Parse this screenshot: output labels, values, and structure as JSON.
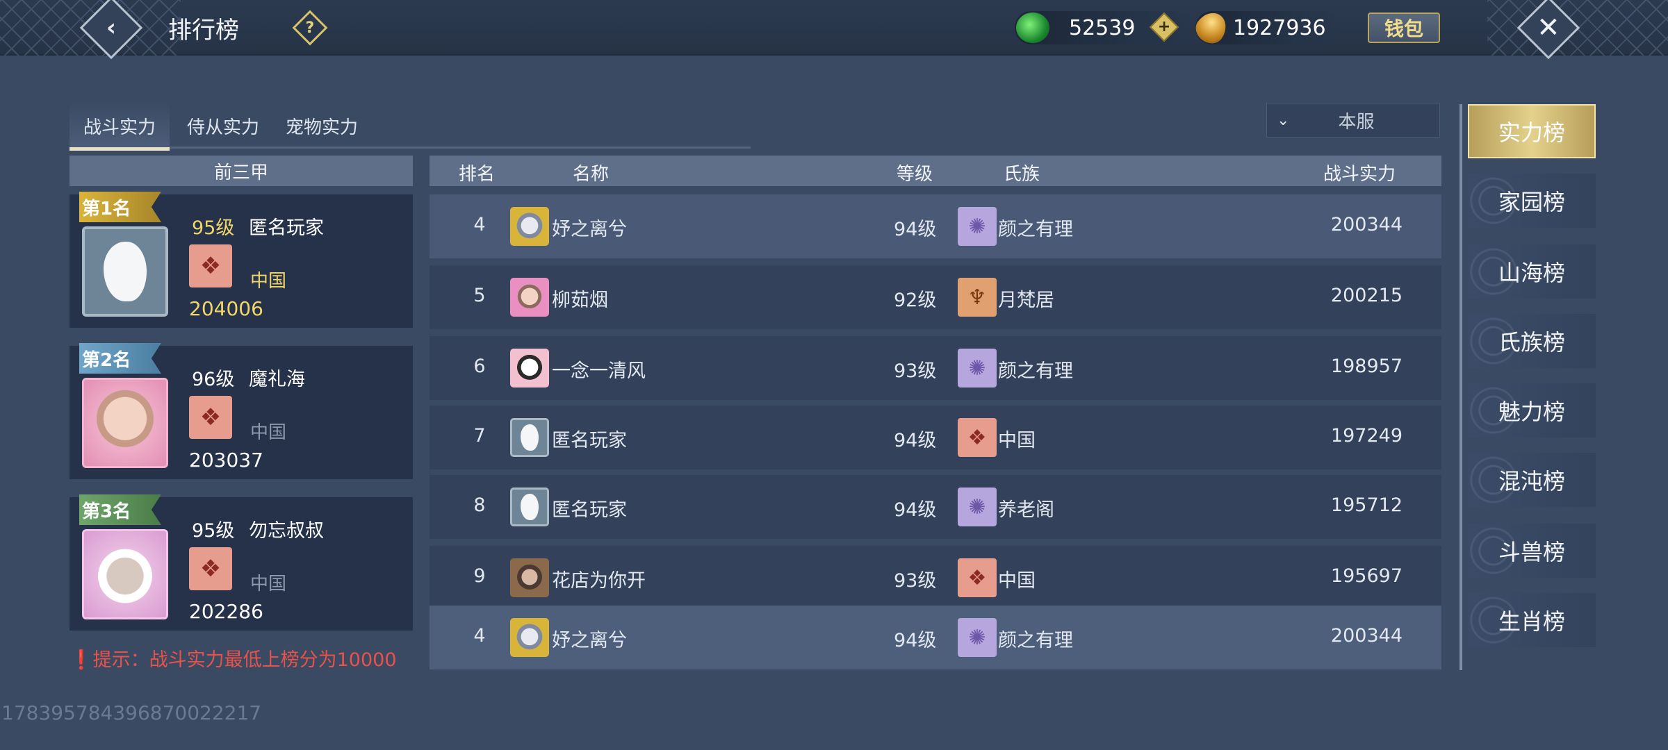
{
  "header": {
    "title": "排行榜",
    "help_icon": "question-icon",
    "jade": "52539",
    "gold": "1927936",
    "wallet_label": "钱包"
  },
  "tabs": [
    "战斗实力",
    "侍从实力",
    "宠物实力"
  ],
  "server_filter": "本服",
  "top3": {
    "title": "前三甲",
    "cards": [
      {
        "rank_label": "第1名",
        "level": "95级",
        "name": "匿名玩家",
        "clan": "中国",
        "power": "204006"
      },
      {
        "rank_label": "第2名",
        "level": "96级",
        "name": "魔礼海",
        "clan": "中国",
        "power": "203037"
      },
      {
        "rank_label": "第3名",
        "level": "95级",
        "name": "勿忘叔叔",
        "clan": "中国",
        "power": "202286"
      }
    ]
  },
  "table": {
    "headers": {
      "rank": "排名",
      "name": "名称",
      "level": "等级",
      "clan": "氏族",
      "power": "战斗实力"
    },
    "rows": [
      {
        "rank": "4",
        "name": "妤之离兮",
        "level": "94级",
        "clan": "颜之有理",
        "power": "200344"
      },
      {
        "rank": "5",
        "name": "柳茹烟",
        "level": "92级",
        "clan": "月梵居",
        "power": "200215"
      },
      {
        "rank": "6",
        "name": "一念一清风",
        "level": "93级",
        "clan": "颜之有理",
        "power": "198957"
      },
      {
        "rank": "7",
        "name": "匿名玩家",
        "level": "94级",
        "clan": "中国",
        "power": "197249"
      },
      {
        "rank": "8",
        "name": "匿名玩家",
        "level": "94级",
        "clan": "养老阁",
        "power": "195712"
      },
      {
        "rank": "9",
        "name": "花店为你开",
        "level": "93级",
        "clan": "中国",
        "power": "195697"
      }
    ],
    "self_row": {
      "rank": "4",
      "name": "妤之离兮",
      "level": "94级",
      "clan": "颜之有理",
      "power": "200344"
    }
  },
  "tip": "提示：战斗实力最低上榜分为10000",
  "categories": [
    "实力榜",
    "家园榜",
    "山海榜",
    "氏族榜",
    "魅力榜",
    "混沌榜",
    "斗兽榜",
    "生肖榜"
  ],
  "footer_id": "178395784396870022217",
  "colors": {
    "accent_gold": "#f1d66a",
    "tip_red": "#e8524a",
    "active_tab": "#e3d18c"
  }
}
